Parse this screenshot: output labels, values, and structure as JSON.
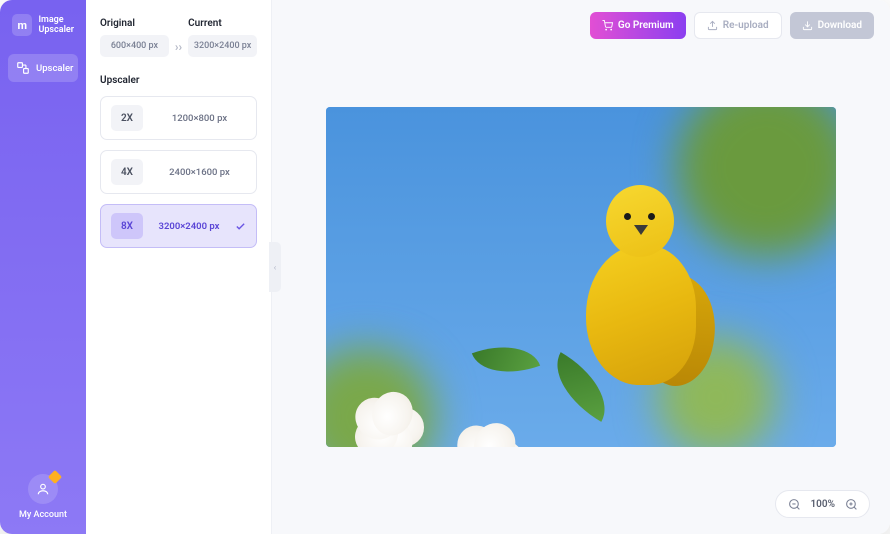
{
  "app": {
    "name_line1": "Image",
    "name_line2": "Upscaler"
  },
  "sidebar": {
    "nav": [
      {
        "label": "Upscaler"
      }
    ],
    "account_label": "My Account"
  },
  "panel": {
    "original_label": "Original",
    "original_size": "600×400 px",
    "current_label": "Current",
    "current_size": "3200×2400 px",
    "arrows": "››",
    "upscaler_label": "Upscaler",
    "options": [
      {
        "mult": "2X",
        "size": "1200×800 px",
        "selected": false
      },
      {
        "mult": "4X",
        "size": "2400×1600 px",
        "selected": false
      },
      {
        "mult": "8X",
        "size": "3200×2400 px",
        "selected": true
      }
    ]
  },
  "topbar": {
    "premium": "Go Premium",
    "reupload": "Re-upload",
    "download": "Download"
  },
  "zoom": {
    "level": "100%"
  },
  "collapse_glyph": "‹"
}
